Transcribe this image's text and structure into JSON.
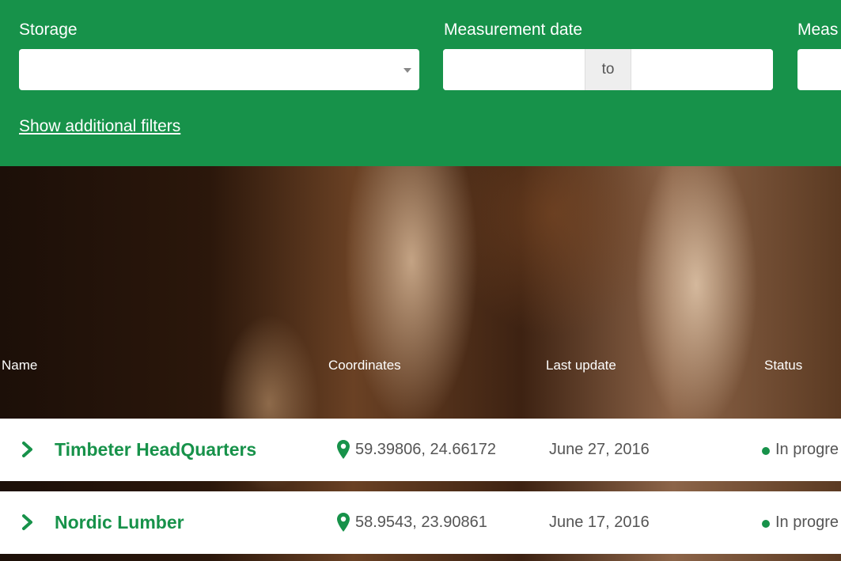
{
  "filters": {
    "storage_label": "Storage",
    "storage_value": "",
    "date_label": "Measurement date",
    "date_from": "",
    "date_sep": "to",
    "date_to": "",
    "third_label": "Meas",
    "more_link": "Show additional filters"
  },
  "table": {
    "headers": {
      "name": "Name",
      "coordinates": "Coordinates",
      "last_update": "Last update",
      "status": "Status"
    },
    "rows": [
      {
        "name": "Timbeter HeadQuarters",
        "coordinates": "59.39806, 24.66172",
        "last_update": "June 27, 2016",
        "status": "In progre"
      },
      {
        "name": "Nordic Lumber",
        "coordinates": "58.9543, 23.90861",
        "last_update": "June 17, 2016",
        "status": "In progre"
      }
    ]
  },
  "icons": {
    "expand": "chevron-right-icon",
    "location": "map-pin-icon",
    "status": "status-dot-icon",
    "dropdown": "caret-down-icon"
  },
  "colors": {
    "brand_green": "#17924a",
    "text_gray": "#555555"
  }
}
